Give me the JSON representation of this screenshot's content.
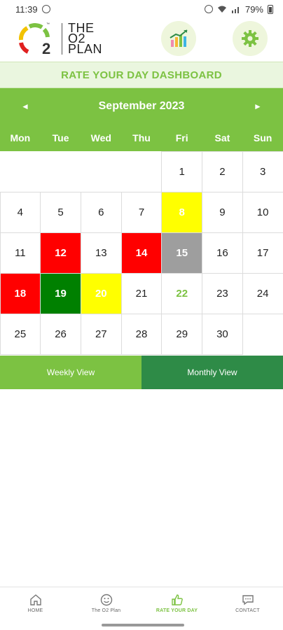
{
  "status_bar": {
    "time": "11:39",
    "battery": "79%"
  },
  "header": {
    "logo_number": "2",
    "logo_tm": "™",
    "logo_lines": [
      "THE",
      "O2",
      "PLAN"
    ],
    "icons": [
      "chart-icon",
      "gear-icon"
    ]
  },
  "dashboard_title": "RATE YOUR DAY DASHBOARD",
  "calendar": {
    "month": "September 2023",
    "prev": "◄",
    "next": "►",
    "weekdays": [
      "Mon",
      "Tue",
      "Wed",
      "Thu",
      "Fri",
      "Sat",
      "Sun"
    ],
    "days": [
      "",
      "",
      "",
      "",
      "1",
      "2",
      "3",
      "4",
      "5",
      "6",
      "7",
      "8",
      "9",
      "10",
      "11",
      "12",
      "13",
      "14",
      "15",
      "16",
      "17",
      "18",
      "19",
      "20",
      "21",
      "22",
      "23",
      "24",
      "25",
      "26",
      "27",
      "28",
      "29",
      "30",
      ""
    ],
    "ratings": {
      "8": "yellow",
      "12": "red",
      "14": "red",
      "15": "gray",
      "18": "red",
      "19": "green",
      "20": "yellow",
      "22": "today"
    },
    "colors": {
      "red": "#ff0000",
      "green": "#008000",
      "yellow": "#ffff00",
      "gray": "#9e9e9e",
      "accent": "#7cc242",
      "dark_green": "#2e8b47"
    }
  },
  "view_toggle": {
    "weekly": "Weekly View",
    "monthly": "Monthly View"
  },
  "bottom_nav": [
    {
      "label": "HOME",
      "icon": "home-icon"
    },
    {
      "label": "The O2 Plan",
      "icon": "smiley-icon"
    },
    {
      "label": "RATE YOUR DAY",
      "icon": "thumbs-up-icon",
      "active": true
    },
    {
      "label": "CONTACT",
      "icon": "chat-icon"
    }
  ]
}
